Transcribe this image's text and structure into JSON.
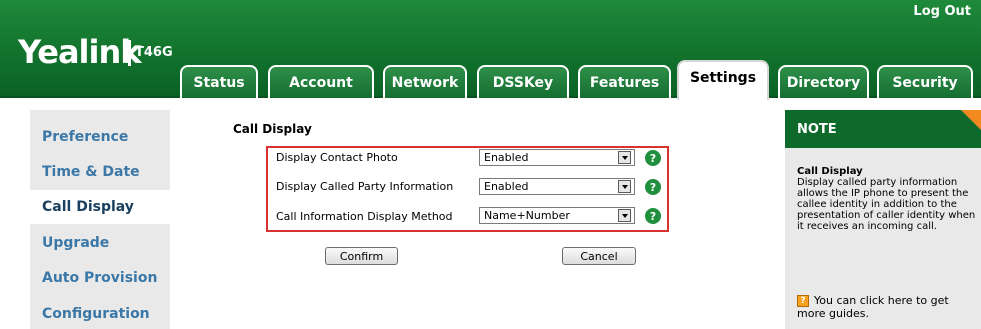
{
  "header": {
    "logo": "Yealink",
    "model": "T46G",
    "logout": "Log Out"
  },
  "tabs": [
    {
      "label": "Status"
    },
    {
      "label": "Account"
    },
    {
      "label": "Network"
    },
    {
      "label": "DSSKey"
    },
    {
      "label": "Features"
    },
    {
      "label": "Settings",
      "active": true
    },
    {
      "label": "Directory"
    },
    {
      "label": "Security"
    }
  ],
  "sidebar": {
    "items": [
      {
        "label": "Preference"
      },
      {
        "label": "Time & Date"
      },
      {
        "label": "Call Display",
        "active": true
      },
      {
        "label": "Upgrade"
      },
      {
        "label": "Auto Provision"
      },
      {
        "label": "Configuration"
      }
    ]
  },
  "main": {
    "title": "Call Display",
    "rows": [
      {
        "label": "Display Contact Photo",
        "value": "Enabled"
      },
      {
        "label": "Display Called Party Information",
        "value": "Enabled"
      },
      {
        "label": "Call Information Display Method",
        "value": "Name+Number"
      }
    ],
    "help_glyph": "?",
    "confirm": "Confirm",
    "cancel": "Cancel"
  },
  "note": {
    "heading": "NOTE",
    "title": "Call Display",
    "body": "Display called party information allows the IP phone to present the callee identity in addition to the presentation of caller identity when it receives an incoming call.",
    "guide_icon": "?",
    "guide": "You can click here to get more guides."
  },
  "colors": {
    "header_green": "#14772f",
    "note_green": "#0d6a2b",
    "sidebar_link": "#3b78a8",
    "highlight_red": "#d9332f",
    "note_corner_orange": "#f28a1f"
  }
}
